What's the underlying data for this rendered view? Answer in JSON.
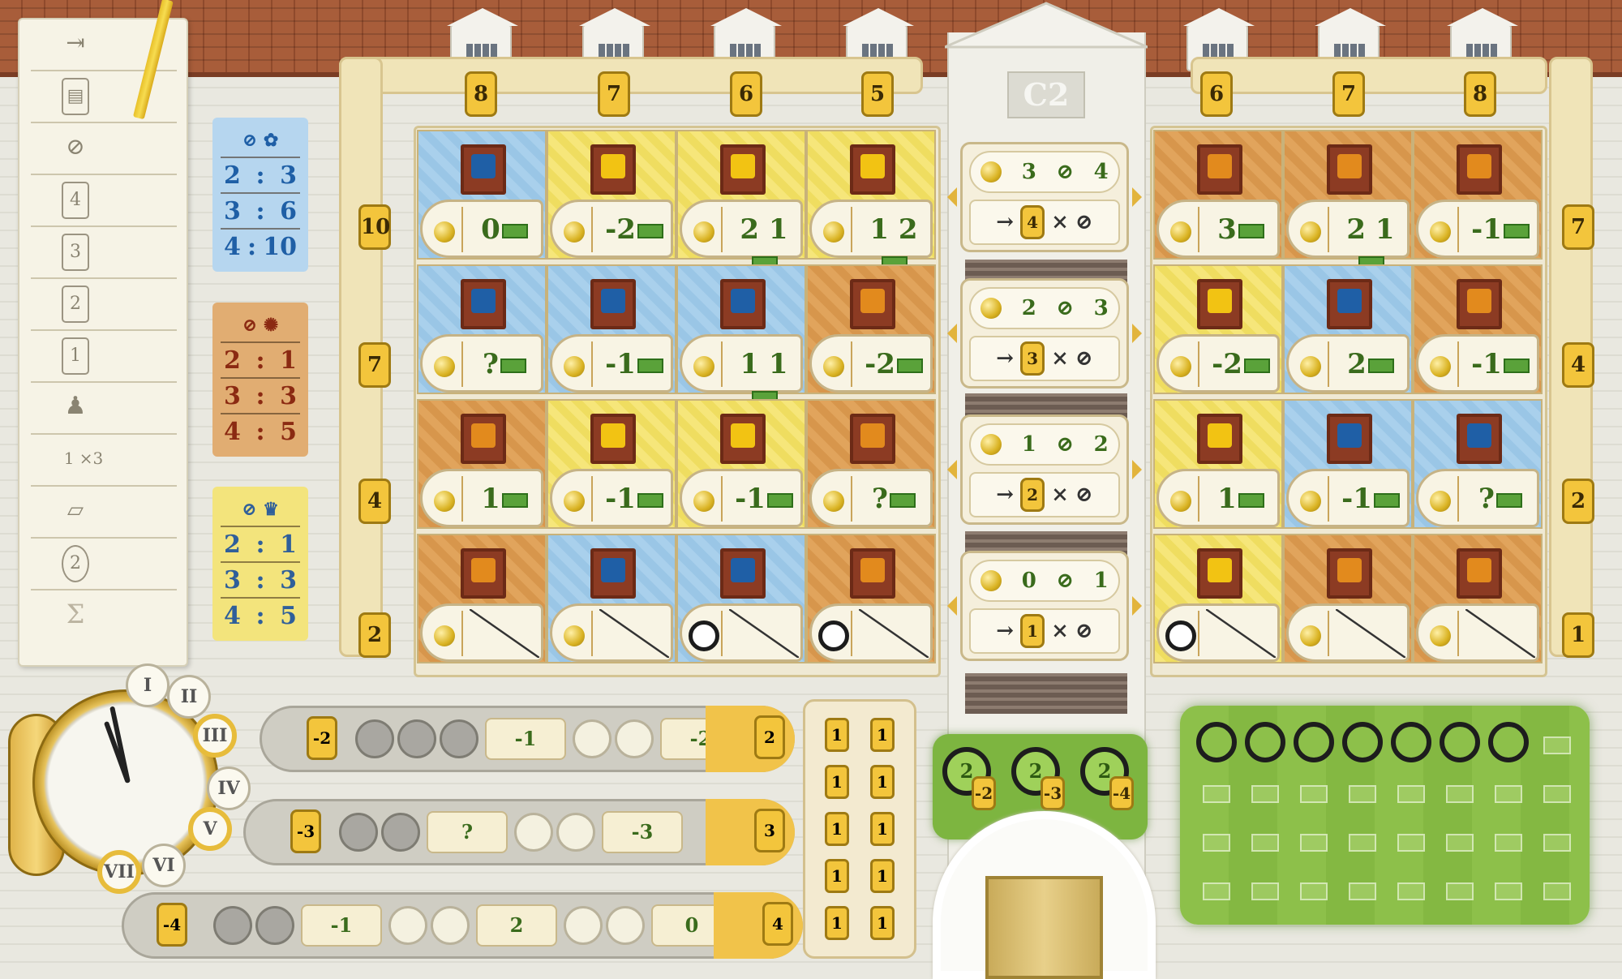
{
  "building": {
    "label": "C2"
  },
  "sheet": {
    "rows": [
      "",
      "",
      "",
      "4",
      "3",
      "2",
      "1",
      "",
      "1 ×3",
      "",
      "2",
      "Σ"
    ]
  },
  "conversion": {
    "blue": {
      "rows": [
        {
          "l": "2",
          "r": "3"
        },
        {
          "l": "3",
          "r": "6"
        },
        {
          "l": "4",
          "r": "10"
        }
      ]
    },
    "orange": {
      "rows": [
        {
          "l": "2",
          "r": "1"
        },
        {
          "l": "3",
          "r": "3"
        },
        {
          "l": "4",
          "r": "5"
        }
      ]
    },
    "yellow": {
      "rows": [
        {
          "l": "2",
          "r": "1"
        },
        {
          "l": "3",
          "r": "3"
        },
        {
          "l": "4",
          "r": "5"
        }
      ]
    }
  },
  "left_top_tags": [
    "8",
    "7",
    "6",
    "5"
  ],
  "right_top_tags": [
    "6",
    "7",
    "8"
  ],
  "left_side_tags": [
    "10",
    "7",
    "4",
    "2"
  ],
  "right_side_tags": [
    "7",
    "4",
    "2",
    "1"
  ],
  "left_rooms": [
    [
      {
        "color": "blue",
        "effect": "0"
      },
      {
        "color": "yellow",
        "effect": "-2"
      },
      {
        "color": "yellow",
        "effect": "2 1"
      },
      {
        "color": "yellow",
        "effect": "1 2"
      }
    ],
    [
      {
        "color": "blue",
        "effect": "?"
      },
      {
        "color": "blue",
        "effect": "-1"
      },
      {
        "color": "blue",
        "effect": "1 1"
      },
      {
        "color": "orange",
        "effect": "-2"
      }
    ],
    [
      {
        "color": "orange",
        "effect": "1"
      },
      {
        "color": "yellow",
        "effect": "-1"
      },
      {
        "color": "yellow",
        "effect": "-1"
      },
      {
        "color": "orange",
        "effect": "?"
      }
    ],
    [
      {
        "color": "orange",
        "effect": ""
      },
      {
        "color": "blue",
        "effect": ""
      },
      {
        "color": "blue",
        "effect": ""
      },
      {
        "color": "orange",
        "effect": ""
      }
    ]
  ],
  "right_rooms": [
    [
      {
        "color": "orange",
        "effect": "3"
      },
      {
        "color": "orange",
        "effect": "2 1"
      },
      {
        "color": "orange",
        "effect": "-1"
      }
    ],
    [
      {
        "color": "yellow",
        "effect": "-2"
      },
      {
        "color": "blue",
        "effect": "2"
      },
      {
        "color": "orange",
        "effect": "-1"
      }
    ],
    [
      {
        "color": "yellow",
        "effect": "1"
      },
      {
        "color": "blue",
        "effect": "-1"
      },
      {
        "color": "blue",
        "effect": "?"
      }
    ],
    [
      {
        "color": "yellow",
        "effect": ""
      },
      {
        "color": "orange",
        "effect": ""
      },
      {
        "color": "orange",
        "effect": ""
      }
    ]
  ],
  "center_panels": [
    {
      "left": "3",
      "right": "4",
      "mult": "4"
    },
    {
      "left": "2",
      "right": "3",
      "mult": "3"
    },
    {
      "left": "1",
      "right": "2",
      "mult": "2"
    },
    {
      "left": "0",
      "right": "1",
      "mult": "1"
    }
  ],
  "clock": {
    "numerals": [
      "I",
      "II",
      "III",
      "IV",
      "V",
      "VI",
      "VII"
    ]
  },
  "rounds": [
    {
      "cost": "-2",
      "card1": "-1",
      "card2": "-2",
      "end": "2"
    },
    {
      "cost": "-3",
      "card1": "?",
      "card2": "-3",
      "end": "3"
    },
    {
      "cost": "-4",
      "card1": "-1",
      "card2": "2",
      "card3": "0",
      "end": "4"
    }
  ],
  "staff_tiles": [
    "1",
    "1",
    "1",
    "1",
    "1",
    "1",
    "1",
    "1",
    "1",
    "1"
  ],
  "garden_small": [
    {
      "top": "2",
      "bottom": "-2"
    },
    {
      "top": "2",
      "bottom": "-3"
    },
    {
      "top": "2",
      "bottom": "-4"
    }
  ],
  "colors": {
    "blue": "#a9d0ec",
    "yellow": "#f6e67a",
    "orange": "#e1a45c",
    "money": "#5aa23a",
    "gold": "#f3c53c"
  }
}
